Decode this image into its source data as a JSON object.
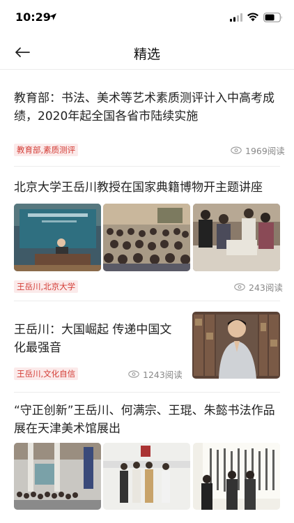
{
  "status_bar": {
    "time": "10:29"
  },
  "nav": {
    "title": "精选"
  },
  "articles": [
    {
      "title": "教育部：书法、美术等艺术素质测评计入中高考成绩，2020年起全国各省市陆续实施",
      "tags": "教育部,素质测评",
      "reads": "1969阅读"
    },
    {
      "title": "北京大学王岳川教授在国家典籍博物开主题讲座",
      "tags": "王岳川,北京大学",
      "reads": "243阅读"
    },
    {
      "title": "王岳川：大国崛起 传递中国文化最强音",
      "tags": "王岳川,文化自信",
      "reads": "1243阅读"
    },
    {
      "title": "“守正创新”王岳川、何满宗、王琨、朱懿书法作品展在天津美术馆展出"
    }
  ],
  "colors": {
    "tag_text": "#d33c35",
    "tag_bg": "#fbeaea",
    "divider": "#ececec",
    "meta_text": "#888888"
  },
  "icons": [
    "location-arrow-icon",
    "signal-icon",
    "wifi-icon",
    "battery-icon",
    "back-arrow-icon",
    "eye-icon"
  ]
}
